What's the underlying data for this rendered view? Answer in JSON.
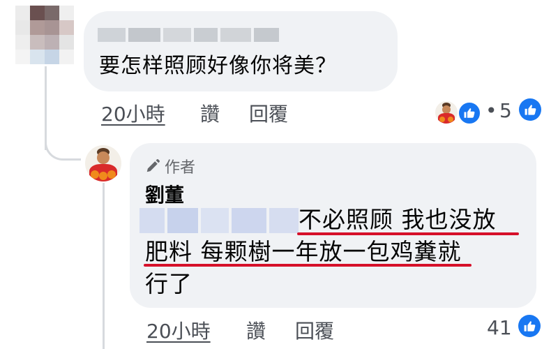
{
  "comment1": {
    "text": "要怎样照顾好像你将美？",
    "time": "20小時",
    "like_label": "讚",
    "reply_label": "回覆",
    "separator": "•",
    "reaction_count": "5"
  },
  "reply": {
    "author_badge": "作者",
    "author_name": "劉董",
    "text_line1": "不必照顾  我也没放",
    "text_line2": "肥料  每颗樹一年放一包鸡糞就",
    "text_line3": "行了",
    "time": "20小時",
    "like_label": "讚",
    "reply_label": "回覆",
    "reaction_count": "41"
  },
  "icons": {
    "like": "thumbs-up-icon",
    "author": "pencil-icon"
  },
  "colors": {
    "accent": "#1877f2",
    "bubble": "#f0f2f5",
    "highlight_underline": "#d6102a"
  }
}
